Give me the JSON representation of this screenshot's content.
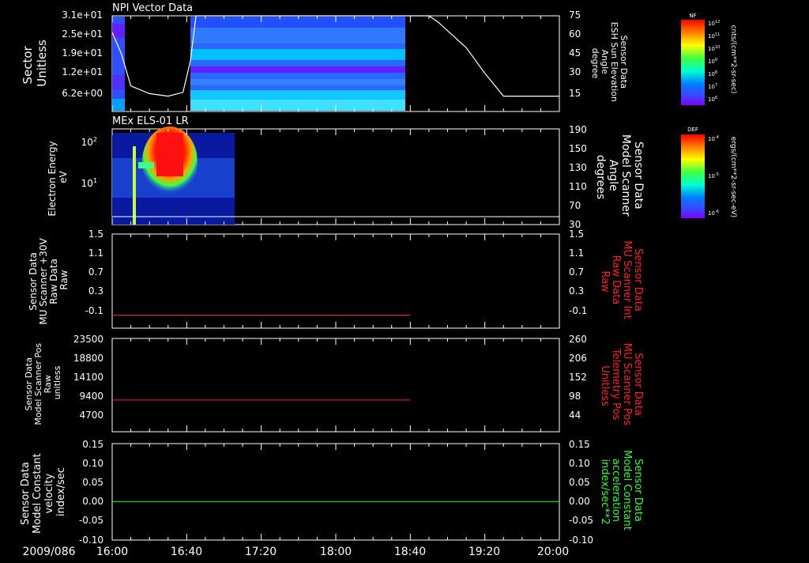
{
  "date_label": "2009/086",
  "time_ticks": [
    "16:00",
    "16:40",
    "17:20",
    "18:00",
    "18:40",
    "19:20",
    "20:00"
  ],
  "colors": {
    "white": "#ffffff",
    "red": "#ff2020",
    "green": "#30ff30",
    "black": "#000000"
  },
  "panels": [
    {
      "title": "NPI Vector Data",
      "left_label": [
        "Sector",
        "Unitless"
      ],
      "left_ticks": [
        "3.1e+01",
        "2.5e+01",
        "1.9e+01",
        "1.2e+01",
        "6.2e+00"
      ],
      "right_label": [
        "Sensor Data",
        "ESH Sun Elevation",
        "Angle",
        "degree"
      ],
      "right_ticks": [
        "75",
        "60",
        "45",
        "30",
        "15"
      ]
    },
    {
      "title": "MEx ELS-01 LR",
      "left_label": [
        "Electron Energy",
        "eV"
      ],
      "left_ticks": [
        "10",
        "10",
        "10"
      ],
      "left_tick_exps": [
        "2",
        "1",
        ""
      ],
      "right_label": [
        "Sensor Data",
        "Model Scanner",
        "Angle",
        "degrees"
      ],
      "right_ticks": [
        "190",
        "150",
        "130",
        "110",
        "70",
        "30"
      ]
    },
    {
      "title": "",
      "left_label": [
        "Sensor Data",
        "MU Scanner +30V",
        "Raw Data",
        "Raw"
      ],
      "left_ticks": [
        "1.5",
        "1.1",
        "0.7",
        "0.3",
        "-0.1"
      ],
      "right_label": [
        "Sensor Data",
        "MU Scanner Int",
        "Raw Data",
        "Raw"
      ],
      "right_ticks": [
        "1.5",
        "1.1",
        "0.7",
        "0.3",
        "-0.1"
      ]
    },
    {
      "title": "",
      "left_label": [
        "Sensor Data",
        "Model Scanner Pos",
        "Raw",
        "unitless"
      ],
      "left_ticks": [
        "23500",
        "18800",
        "14100",
        "9400",
        "4700"
      ],
      "right_label": [
        "Sensor Data",
        "MU Scanner Pos",
        "Telemetry Pos",
        "Unitless"
      ],
      "right_ticks": [
        "260",
        "206",
        "152",
        "98",
        "44"
      ]
    },
    {
      "title": "",
      "left_label": [
        "Sensor Data",
        "Model Constant",
        "velocity",
        "index/sec"
      ],
      "left_ticks": [
        "0.15",
        "0.10",
        "0.05",
        "0.00",
        "-0.05",
        "-0.10"
      ],
      "right_label": [
        "Sensor Data",
        "Model Constant",
        "acceleration",
        "index/sec**2"
      ],
      "right_ticks": [
        "0.15",
        "0.10",
        "0.05",
        "0.00",
        "-0.05",
        "-0.10"
      ]
    }
  ],
  "colorbars": [
    {
      "tag": "NF",
      "unit": "cnts/(cm**2-sr-sec)",
      "ticks": [
        "10",
        "10",
        "10",
        "10",
        "10",
        "10",
        "10"
      ],
      "tick_exps": [
        "12",
        "11",
        "10",
        "9",
        "8",
        "7",
        "6"
      ]
    },
    {
      "tag": "DEF",
      "unit": "ergs/(cm**2-sr-sec-eV)",
      "ticks": [
        "10",
        "10",
        "10"
      ],
      "tick_exps": [
        "-4",
        "-5",
        "-6"
      ]
    }
  ],
  "chart_data": [
    {
      "type": "heatmap",
      "title": "NPI Vector Data",
      "xlabel": "",
      "ylabel": "Sector Unitless",
      "x_range": [
        "16:00",
        "20:00"
      ],
      "ylim": [
        0,
        31
      ],
      "data_coverage": [
        [
          "16:00",
          "16:08"
        ],
        [
          "16:42",
          "18:40"
        ]
      ],
      "overlay_series": {
        "name": "ESH Sun Elevation Angle",
        "y_axis": "right",
        "ylim": [
          0,
          75
        ],
        "x": [
          "16:00",
          "16:05",
          "16:10",
          "16:20",
          "16:30",
          "16:38",
          "16:42",
          "16:45",
          "18:50",
          "18:55",
          "19:10",
          "19:20",
          "19:30",
          "20:00"
        ],
        "values": [
          62,
          45,
          20,
          14,
          12,
          15,
          40,
          75,
          75,
          70,
          50,
          30,
          12,
          12
        ]
      }
    },
    {
      "type": "heatmap",
      "title": "MEx ELS-01 LR",
      "xlabel": "",
      "ylabel": "Electron Energy eV",
      "y_scale": "log",
      "x_range": [
        "16:00",
        "20:00"
      ],
      "data_coverage": [
        [
          "16:00",
          "16:55"
        ]
      ],
      "overlay_series": {
        "name": "Model Scanner Angle",
        "y_axis": "right",
        "ylim": [
          0,
          190
        ],
        "x": [
          "16:00",
          "20:00"
        ],
        "values": [
          5,
          5
        ]
      }
    },
    {
      "type": "line",
      "xlabel": "",
      "ylabel": "MU Scanner +30V Raw Data Raw",
      "ylim": [
        -0.3,
        1.5
      ],
      "series": [
        {
          "name": "MU Scanner Int Raw Data Raw",
          "color": "#ff2020",
          "x": [
            "16:00",
            "18:40"
          ],
          "values": [
            -0.05,
            -0.05
          ]
        }
      ]
    },
    {
      "type": "line",
      "xlabel": "",
      "ylabel": "Model Scanner Pos Raw unitless",
      "ylim": [
        0,
        23500
      ],
      "series": [
        {
          "name": "MU Scanner Pos Telemetry Pos Unitless",
          "color": "#ff2020",
          "x": [
            "16:00",
            "18:40"
          ],
          "values": [
            8000,
            8000
          ]
        }
      ]
    },
    {
      "type": "line",
      "xlabel": "",
      "ylabel": "Model Constant velocity index/sec",
      "ylim": [
        -0.1,
        0.15
      ],
      "series": [
        {
          "name": "Model Constant acceleration index/sec**2",
          "color": "#30ff30",
          "x": [
            "16:00",
            "20:00"
          ],
          "values": [
            0.0,
            0.0
          ]
        }
      ]
    }
  ]
}
